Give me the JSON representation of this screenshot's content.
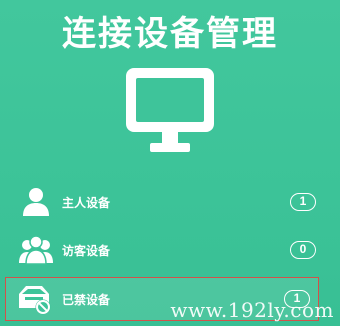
{
  "title": "连接设备管理",
  "icons": {
    "monitor": "monitor-icon",
    "host": "user-icon",
    "guest": "users-group-icon",
    "blocked": "blocked-device-icon"
  },
  "devices": [
    {
      "label": "主人设备",
      "count": "1"
    },
    {
      "label": "访客设备",
      "count": "0"
    },
    {
      "label": "已禁设备",
      "count": "1"
    }
  ],
  "watermark": "www.192ly.com",
  "colors": {
    "background": "#3ec49a",
    "foreground": "#ffffff",
    "highlight_border": "#d2524a"
  }
}
